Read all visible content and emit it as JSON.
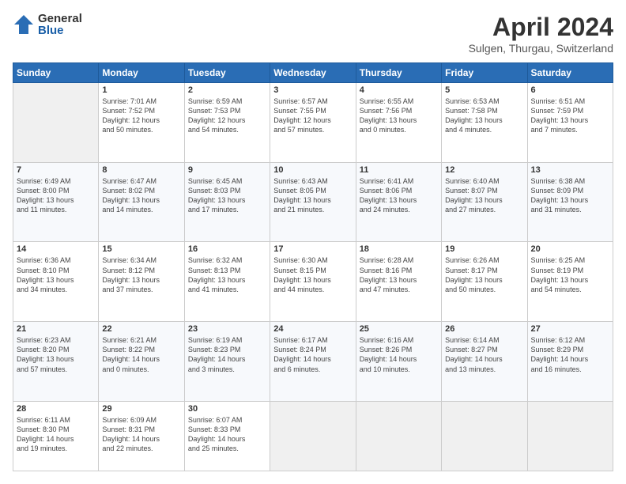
{
  "header": {
    "logo_general": "General",
    "logo_blue": "Blue",
    "month_title": "April 2024",
    "location": "Sulgen, Thurgau, Switzerland"
  },
  "days_of_week": [
    "Sunday",
    "Monday",
    "Tuesday",
    "Wednesday",
    "Thursday",
    "Friday",
    "Saturday"
  ],
  "weeks": [
    [
      {
        "day": "",
        "info": ""
      },
      {
        "day": "1",
        "info": "Sunrise: 7:01 AM\nSunset: 7:52 PM\nDaylight: 12 hours\nand 50 minutes."
      },
      {
        "day": "2",
        "info": "Sunrise: 6:59 AM\nSunset: 7:53 PM\nDaylight: 12 hours\nand 54 minutes."
      },
      {
        "day": "3",
        "info": "Sunrise: 6:57 AM\nSunset: 7:55 PM\nDaylight: 12 hours\nand 57 minutes."
      },
      {
        "day": "4",
        "info": "Sunrise: 6:55 AM\nSunset: 7:56 PM\nDaylight: 13 hours\nand 0 minutes."
      },
      {
        "day": "5",
        "info": "Sunrise: 6:53 AM\nSunset: 7:58 PM\nDaylight: 13 hours\nand 4 minutes."
      },
      {
        "day": "6",
        "info": "Sunrise: 6:51 AM\nSunset: 7:59 PM\nDaylight: 13 hours\nand 7 minutes."
      }
    ],
    [
      {
        "day": "7",
        "info": "Sunrise: 6:49 AM\nSunset: 8:00 PM\nDaylight: 13 hours\nand 11 minutes."
      },
      {
        "day": "8",
        "info": "Sunrise: 6:47 AM\nSunset: 8:02 PM\nDaylight: 13 hours\nand 14 minutes."
      },
      {
        "day": "9",
        "info": "Sunrise: 6:45 AM\nSunset: 8:03 PM\nDaylight: 13 hours\nand 17 minutes."
      },
      {
        "day": "10",
        "info": "Sunrise: 6:43 AM\nSunset: 8:05 PM\nDaylight: 13 hours\nand 21 minutes."
      },
      {
        "day": "11",
        "info": "Sunrise: 6:41 AM\nSunset: 8:06 PM\nDaylight: 13 hours\nand 24 minutes."
      },
      {
        "day": "12",
        "info": "Sunrise: 6:40 AM\nSunset: 8:07 PM\nDaylight: 13 hours\nand 27 minutes."
      },
      {
        "day": "13",
        "info": "Sunrise: 6:38 AM\nSunset: 8:09 PM\nDaylight: 13 hours\nand 31 minutes."
      }
    ],
    [
      {
        "day": "14",
        "info": "Sunrise: 6:36 AM\nSunset: 8:10 PM\nDaylight: 13 hours\nand 34 minutes."
      },
      {
        "day": "15",
        "info": "Sunrise: 6:34 AM\nSunset: 8:12 PM\nDaylight: 13 hours\nand 37 minutes."
      },
      {
        "day": "16",
        "info": "Sunrise: 6:32 AM\nSunset: 8:13 PM\nDaylight: 13 hours\nand 41 minutes."
      },
      {
        "day": "17",
        "info": "Sunrise: 6:30 AM\nSunset: 8:15 PM\nDaylight: 13 hours\nand 44 minutes."
      },
      {
        "day": "18",
        "info": "Sunrise: 6:28 AM\nSunset: 8:16 PM\nDaylight: 13 hours\nand 47 minutes."
      },
      {
        "day": "19",
        "info": "Sunrise: 6:26 AM\nSunset: 8:17 PM\nDaylight: 13 hours\nand 50 minutes."
      },
      {
        "day": "20",
        "info": "Sunrise: 6:25 AM\nSunset: 8:19 PM\nDaylight: 13 hours\nand 54 minutes."
      }
    ],
    [
      {
        "day": "21",
        "info": "Sunrise: 6:23 AM\nSunset: 8:20 PM\nDaylight: 13 hours\nand 57 minutes."
      },
      {
        "day": "22",
        "info": "Sunrise: 6:21 AM\nSunset: 8:22 PM\nDaylight: 14 hours\nand 0 minutes."
      },
      {
        "day": "23",
        "info": "Sunrise: 6:19 AM\nSunset: 8:23 PM\nDaylight: 14 hours\nand 3 minutes."
      },
      {
        "day": "24",
        "info": "Sunrise: 6:17 AM\nSunset: 8:24 PM\nDaylight: 14 hours\nand 6 minutes."
      },
      {
        "day": "25",
        "info": "Sunrise: 6:16 AM\nSunset: 8:26 PM\nDaylight: 14 hours\nand 10 minutes."
      },
      {
        "day": "26",
        "info": "Sunrise: 6:14 AM\nSunset: 8:27 PM\nDaylight: 14 hours\nand 13 minutes."
      },
      {
        "day": "27",
        "info": "Sunrise: 6:12 AM\nSunset: 8:29 PM\nDaylight: 14 hours\nand 16 minutes."
      }
    ],
    [
      {
        "day": "28",
        "info": "Sunrise: 6:11 AM\nSunset: 8:30 PM\nDaylight: 14 hours\nand 19 minutes."
      },
      {
        "day": "29",
        "info": "Sunrise: 6:09 AM\nSunset: 8:31 PM\nDaylight: 14 hours\nand 22 minutes."
      },
      {
        "day": "30",
        "info": "Sunrise: 6:07 AM\nSunset: 8:33 PM\nDaylight: 14 hours\nand 25 minutes."
      },
      {
        "day": "",
        "info": ""
      },
      {
        "day": "",
        "info": ""
      },
      {
        "day": "",
        "info": ""
      },
      {
        "day": "",
        "info": ""
      }
    ]
  ]
}
